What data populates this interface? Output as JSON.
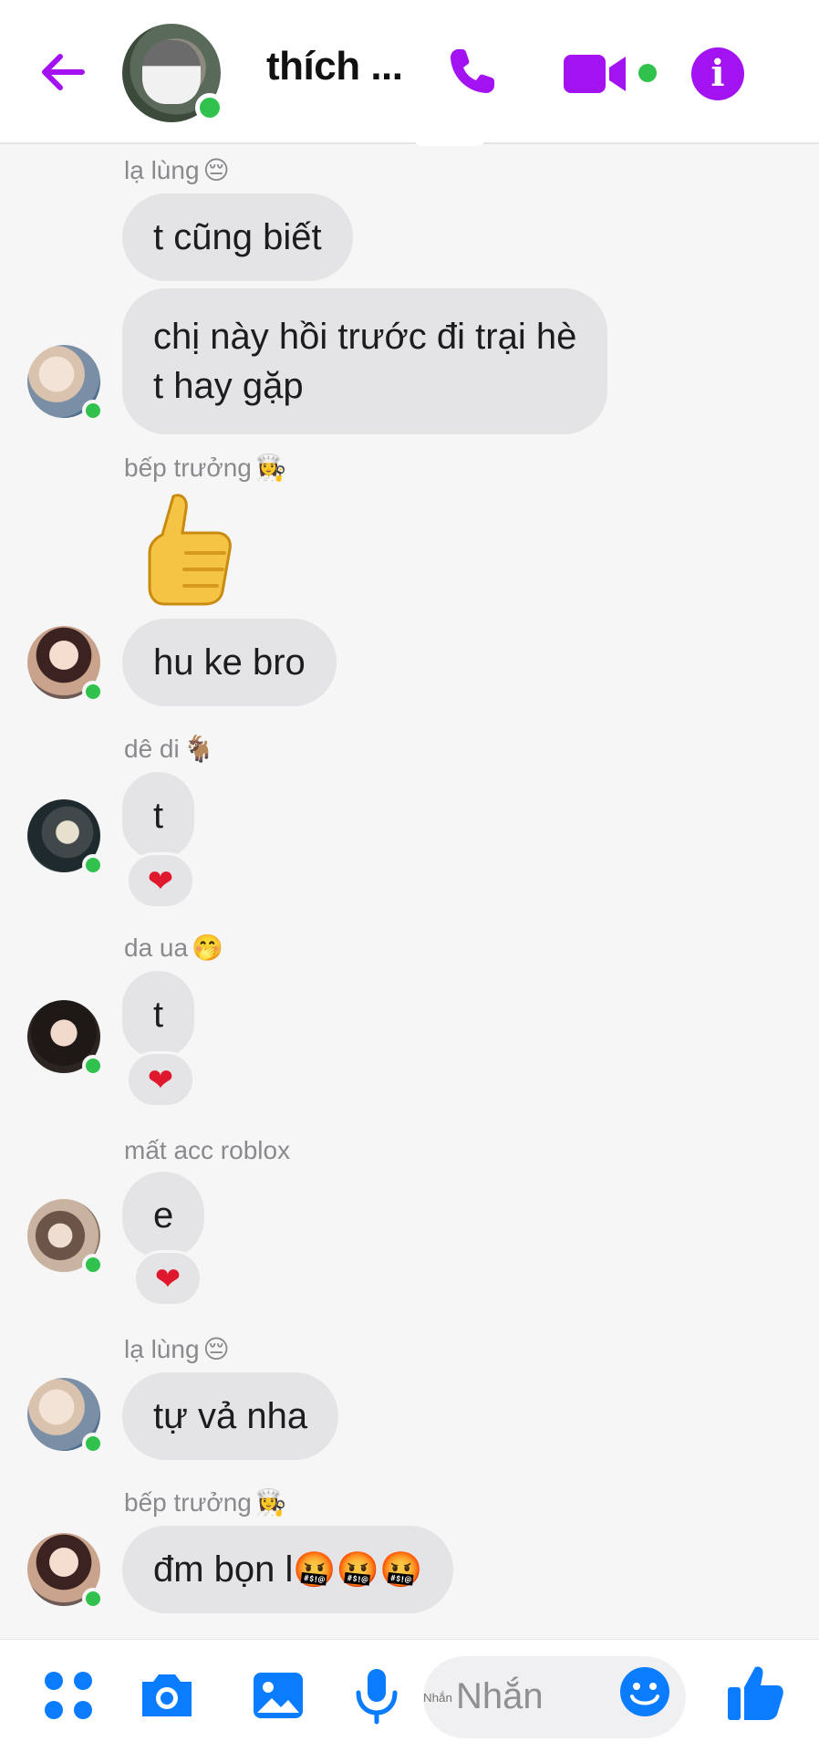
{
  "header": {
    "title": "thích ...",
    "accent_color": "#a313f2",
    "icons": [
      "back-arrow-icon",
      "phone-icon",
      "video-camera-icon",
      "info-icon"
    ]
  },
  "messages": [
    {
      "sender": "lạ lùng",
      "sender_emoji": "😔",
      "bubbles": [
        "t cũng biết",
        "chị này hồi trước đi trại hè\nt hay gặp"
      ]
    },
    {
      "sender": "bếp trưởng",
      "sender_emoji": "👩‍🍳",
      "sticker": "thumbs-up",
      "bubbles": [
        "hu ke bro"
      ]
    },
    {
      "sender": "dê di",
      "sender_emoji": "🐐",
      "bubbles": [
        "t"
      ],
      "reaction": "❤"
    },
    {
      "sender": "da ua",
      "sender_emoji": "🤭",
      "bubbles": [
        "t"
      ],
      "reaction": "❤"
    },
    {
      "sender": "mất acc roblox",
      "sender_emoji": "",
      "bubbles": [
        "e"
      ],
      "reaction": "❤"
    },
    {
      "sender": "lạ lùng",
      "sender_emoji": "😔",
      "bubbles": [
        "tự vả nha"
      ]
    },
    {
      "sender": "bếp trưởng",
      "sender_emoji": "👩‍🍳",
      "bubbles": [
        "đm bọn l"
      ],
      "bubble_emojis": "🤬🤬🤬"
    }
  ],
  "composer": {
    "placeholder": "Nhắn",
    "icon_color": "#0a7cff",
    "icons": [
      "apps-icon",
      "camera-icon",
      "gallery-icon",
      "microphone-icon",
      "emoji-icon",
      "thumbs-up-icon"
    ]
  }
}
